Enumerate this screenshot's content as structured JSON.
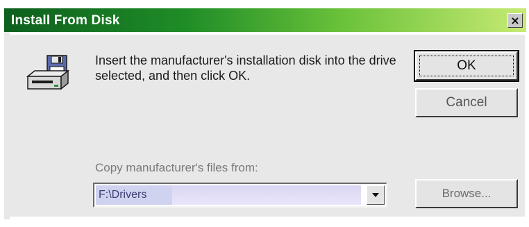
{
  "dialog": {
    "title": "Install From Disk",
    "close_glyph": "×",
    "message": "Insert the manufacturer's installation disk into the drive selected, and then click OK.",
    "icon": "floppy-disk-drive-icon"
  },
  "buttons": {
    "ok_label": "OK",
    "cancel_label": "Cancel",
    "browse_label": "Browse..."
  },
  "copy_from": {
    "label": "Copy manufacturer's files from:",
    "value": "F:\\Drivers",
    "dropdown_icon": "chevron-down-icon"
  },
  "colors": {
    "titlebar_start": "#0d5f1d",
    "titlebar_end": "#c7ea74",
    "dialog_face": "#e8e8e8"
  }
}
